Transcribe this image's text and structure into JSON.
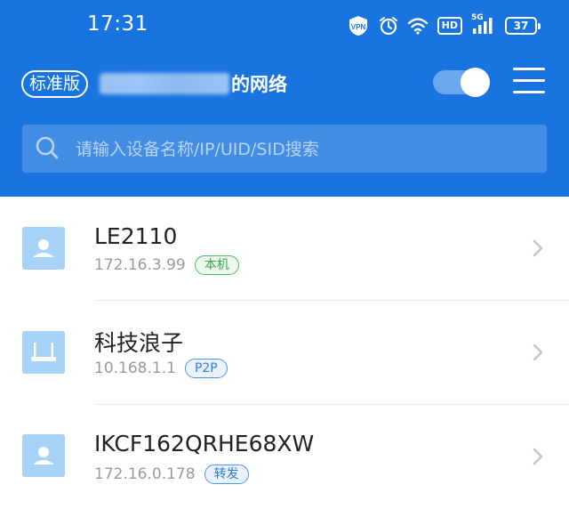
{
  "status_bar": {
    "time": "17:31",
    "icons": [
      "vpn-icon",
      "alarm-icon",
      "wifi-icon",
      "hd-icon",
      "signal-5g-icon",
      "battery-icon"
    ],
    "vpn_label": "VPN",
    "hd_label": "HD",
    "network_type": "5G",
    "battery": "37"
  },
  "header": {
    "edition_badge": "标准版",
    "network_name_suffix": "的网络",
    "toggle_on": true,
    "menu_icon": "hamburger-menu-icon"
  },
  "search": {
    "placeholder": "请输入设备名称/IP/UID/SID搜索",
    "value": ""
  },
  "devices": [
    {
      "name": "LE2110",
      "ip": "172.16.3.99",
      "tag": "本机",
      "tag_color": "#3aa34a",
      "icon": "user-device-icon"
    },
    {
      "name": "科技浪子",
      "ip": "10.168.1.1",
      "tag": "P2P",
      "tag_color": "#2a7de1",
      "icon": "router-icon"
    },
    {
      "name": "IKCF162QRHE68XW",
      "ip": "172.16.0.178",
      "tag": "转发",
      "tag_color": "#2a7de1",
      "icon": "user-device-icon"
    }
  ],
  "colors": {
    "header_bg": "#1a74e0",
    "device_icon_bg": "#a6d3f7"
  }
}
